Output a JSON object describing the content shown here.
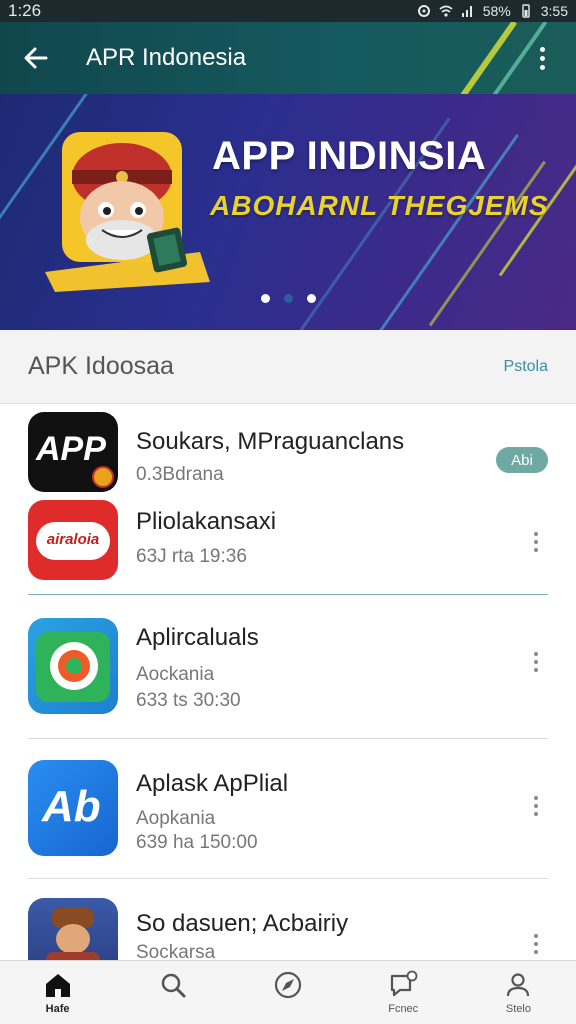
{
  "status_bar": {
    "time": "1:26",
    "battery": "58%",
    "clock_right": "3:55"
  },
  "app_bar": {
    "title": "APR Indonesia"
  },
  "banner": {
    "title": "APP INDINSIA",
    "subtitle": "ABOHARNL THEGJEMS",
    "dot_count": 3,
    "active_dot": 1
  },
  "section": {
    "title": "APK Idoosaa",
    "link": "Pstola"
  },
  "apps": [
    {
      "name": "Soukars, MPraguanclans",
      "line2": "0.3Bdrana",
      "line3": "",
      "badge": "Abi"
    },
    {
      "name": "Pliolakansaxi",
      "line2": "",
      "line3": "63J rta 19:36",
      "icon_text": "airaloia"
    },
    {
      "name": "Aplircaluals",
      "line2": "Aockania",
      "line3": "633 ts 30:30"
    },
    {
      "name": "Aplask ApPlial",
      "line2": "Aopkania",
      "line3": "639 ha 150:00"
    },
    {
      "name": "So dasuen; Acbairiy",
      "line2": "Sockarsa",
      "line3": ""
    }
  ],
  "app1_icon_text": "APP",
  "app4_icon_text": "Ab",
  "bottom_nav": [
    {
      "label": "Hafe",
      "icon": "home-icon"
    },
    {
      "label": "",
      "icon": "search-icon"
    },
    {
      "label": "",
      "icon": "compass-icon"
    },
    {
      "label": "Fcnec",
      "icon": "chat-bubble-icon"
    },
    {
      "label": "Stelo",
      "icon": "person-icon"
    }
  ],
  "colors": {
    "app_bar": "#155a5f",
    "banner": "#2a2f8e",
    "accent": "#3a8fa3",
    "badge": "#6fa9a4"
  }
}
